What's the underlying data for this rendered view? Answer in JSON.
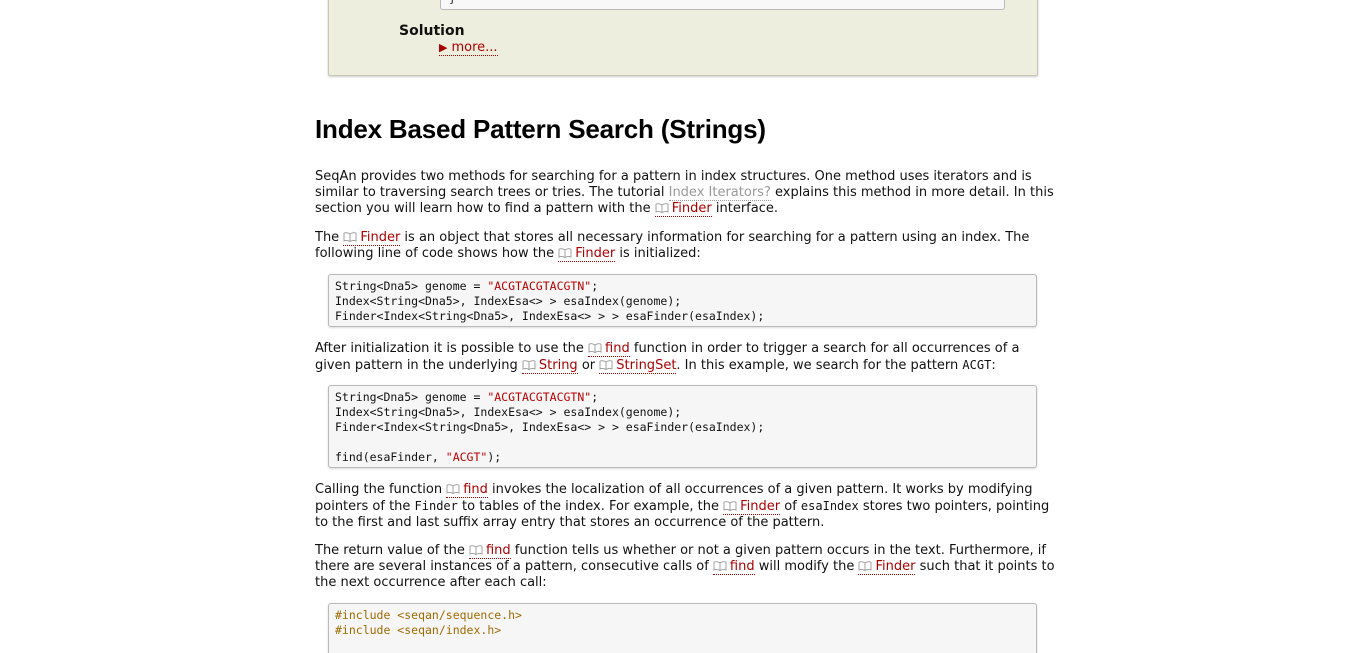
{
  "assignment": {
    "code_tail": "}",
    "solution_label": "Solution",
    "more_link": "more..."
  },
  "section": {
    "title": "Index Based Pattern Search (Strings)"
  },
  "p1": {
    "t1": "SeqAn provides two methods for searching for a pattern in index structures. One method uses iterators and is similar to traversing search trees or tries. The tutorial ",
    "link_tutorial": "Index Iterators?",
    "t2": " explains this method in more detail. In this section you will learn how to find a pattern with the ",
    "link_finder": "Finder",
    "t3": " interface."
  },
  "p2": {
    "t1": "The ",
    "link_finder1": "Finder",
    "t2": " is an object that stores all necessary information for searching for a pattern using an index. The following line of code shows how the ",
    "link_finder2": "Finder",
    "t3": " is initialized:"
  },
  "code1": {
    "l1a": "String<Dna5> genome = ",
    "l1s": "\"ACGTACGTACGTN\"",
    "l1b": ";",
    "l2": "Index<String<Dna5>, IndexEsa<> > esaIndex(genome);",
    "l3": "Finder<Index<String<Dna5>, IndexEsa<> > > esaFinder(esaIndex);"
  },
  "p3": {
    "t1": "After initialization it is possible to use the ",
    "link_find": "find",
    "t2": " function in order to trigger a search for all occurrences of a given pattern in the underlying ",
    "link_string": "String",
    "t3": " or ",
    "link_stringset": "StringSet",
    "t4": ". In this example, we search for the pattern ",
    "code_acgt": "ACGT",
    "t5": ":"
  },
  "code2": {
    "l1a": "String<Dna5> genome = ",
    "l1s": "\"ACGTACGTACGTN\"",
    "l1b": ";",
    "l2": "Index<String<Dna5>, IndexEsa<> > esaIndex(genome);",
    "l3": "Finder<Index<String<Dna5>, IndexEsa<> > > esaFinder(esaIndex);",
    "l5a": "find(esaFinder, ",
    "l5s": "\"ACGT\"",
    "l5b": ");"
  },
  "p4": {
    "t1": "Calling the function ",
    "link_find": "find",
    "t2": " invokes the localization of all occurrences of a given pattern. It works by modifying pointers of the ",
    "code_finder": "Finder",
    "t3": " to tables of the index. For example, the ",
    "link_finder": "Finder",
    "t4": " of ",
    "code_esaindex": "esaIndex",
    "t5": " stores two pointers, pointing to the first and last suffix array entry that stores an occurrence of the pattern."
  },
  "p5": {
    "t1": "The return value of the ",
    "link_find1": "find",
    "t2": " function tells us whether or not a given pattern occurs in the text. Furthermore, if there are several instances of a pattern, consecutive calls of ",
    "link_find2": "find",
    "t3": " will modify the ",
    "link_finder": "Finder",
    "t4": " such that it points to the next occurrence after each call:"
  },
  "code3": {
    "l1": "#include <seqan/sequence.h>",
    "l2": "#include <seqan/index.h>"
  },
  "icons": {
    "doc_link": "book-icon",
    "expand": "triangle-right-icon"
  },
  "colors": {
    "link": "#aa0000",
    "assignment_bg": "#eeeedf",
    "code_bg": "#f6f6f6",
    "string_literal": "#bb0000",
    "preprocessor": "#a06a00"
  }
}
